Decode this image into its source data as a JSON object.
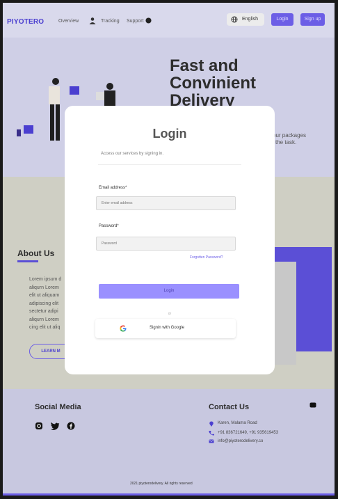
{
  "header": {
    "logo": "PIYOTERO",
    "nav": {
      "overview": "Overview",
      "tracking": "Tracking",
      "support": "Support"
    },
    "language": "English",
    "login": "Login",
    "signup": "Sign up"
  },
  "hero": {
    "title_lines": [
      "Fast and",
      "Convinient",
      "Delivery"
    ],
    "subtitle_lines": [
      "your packages",
      "the task."
    ]
  },
  "about": {
    "title": "About Us",
    "text_lines": [
      "Lorem ipsum d",
      "aliqurn Lorem",
      "elit ut aliquam",
      "adipiscing elit",
      "sectetur adipi",
      "aliqurn Lorem",
      "cing elit ut aliq"
    ],
    "learn_more": "LEARN M"
  },
  "modal": {
    "title": "Login",
    "subtitle": "Access our services by signing in.",
    "email_label": "Email address*",
    "email_placeholder": "Enter email address",
    "password_label": "Password*",
    "password_placeholder": "Password",
    "forgot": "Forgotten  Password?",
    "login_button": "Login",
    "or": "or",
    "google_button": "Signin with Google"
  },
  "footer": {
    "social_title": "Social Media",
    "contact_title": "Contact Us",
    "address": "Karen, Malama Road",
    "phone": "+91 836721649, +91 935619453",
    "email": "info@piyoterodelivery.co",
    "copyright": "2021 piyoterodelivery. All rights reserved"
  },
  "colors": {
    "accent": "#6c5ee6",
    "accent_light": "#9a90ff"
  }
}
